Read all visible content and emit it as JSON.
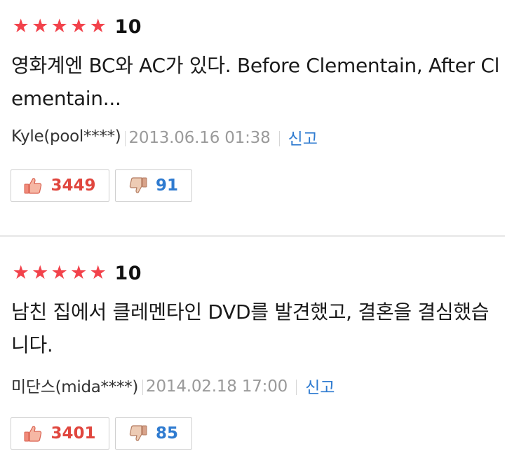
{
  "reviews": [
    {
      "stars": [
        "★",
        "★",
        "★",
        "★",
        "★"
      ],
      "score": "10",
      "comment": "영화계엔 BC와 AC가 있다. Before Clementain, After Clementain...",
      "author": "Kyle(pool****)",
      "date": "2013.06.16 01:38",
      "report_label": "신고",
      "likes": "3449",
      "dislikes": "91"
    },
    {
      "stars": [
        "★",
        "★",
        "★",
        "★",
        "★"
      ],
      "score": "10",
      "comment": "남친 집에서 클레멘타인 DVD를 발견했고, 결혼을 결심했습니다.",
      "author": "미단스(mida****)",
      "date": "2014.02.18 17:00",
      "report_label": "신고",
      "likes": "3401",
      "dislikes": "85"
    }
  ],
  "colors": {
    "star": "#f2424b",
    "like": "#e0463e",
    "dislike": "#2f7bd0",
    "report": "#2f7bd0",
    "date": "#9a9a9a"
  },
  "icons": {
    "like": "thumbs-up-icon",
    "dislike": "thumbs-down-icon",
    "star": "star-icon"
  }
}
